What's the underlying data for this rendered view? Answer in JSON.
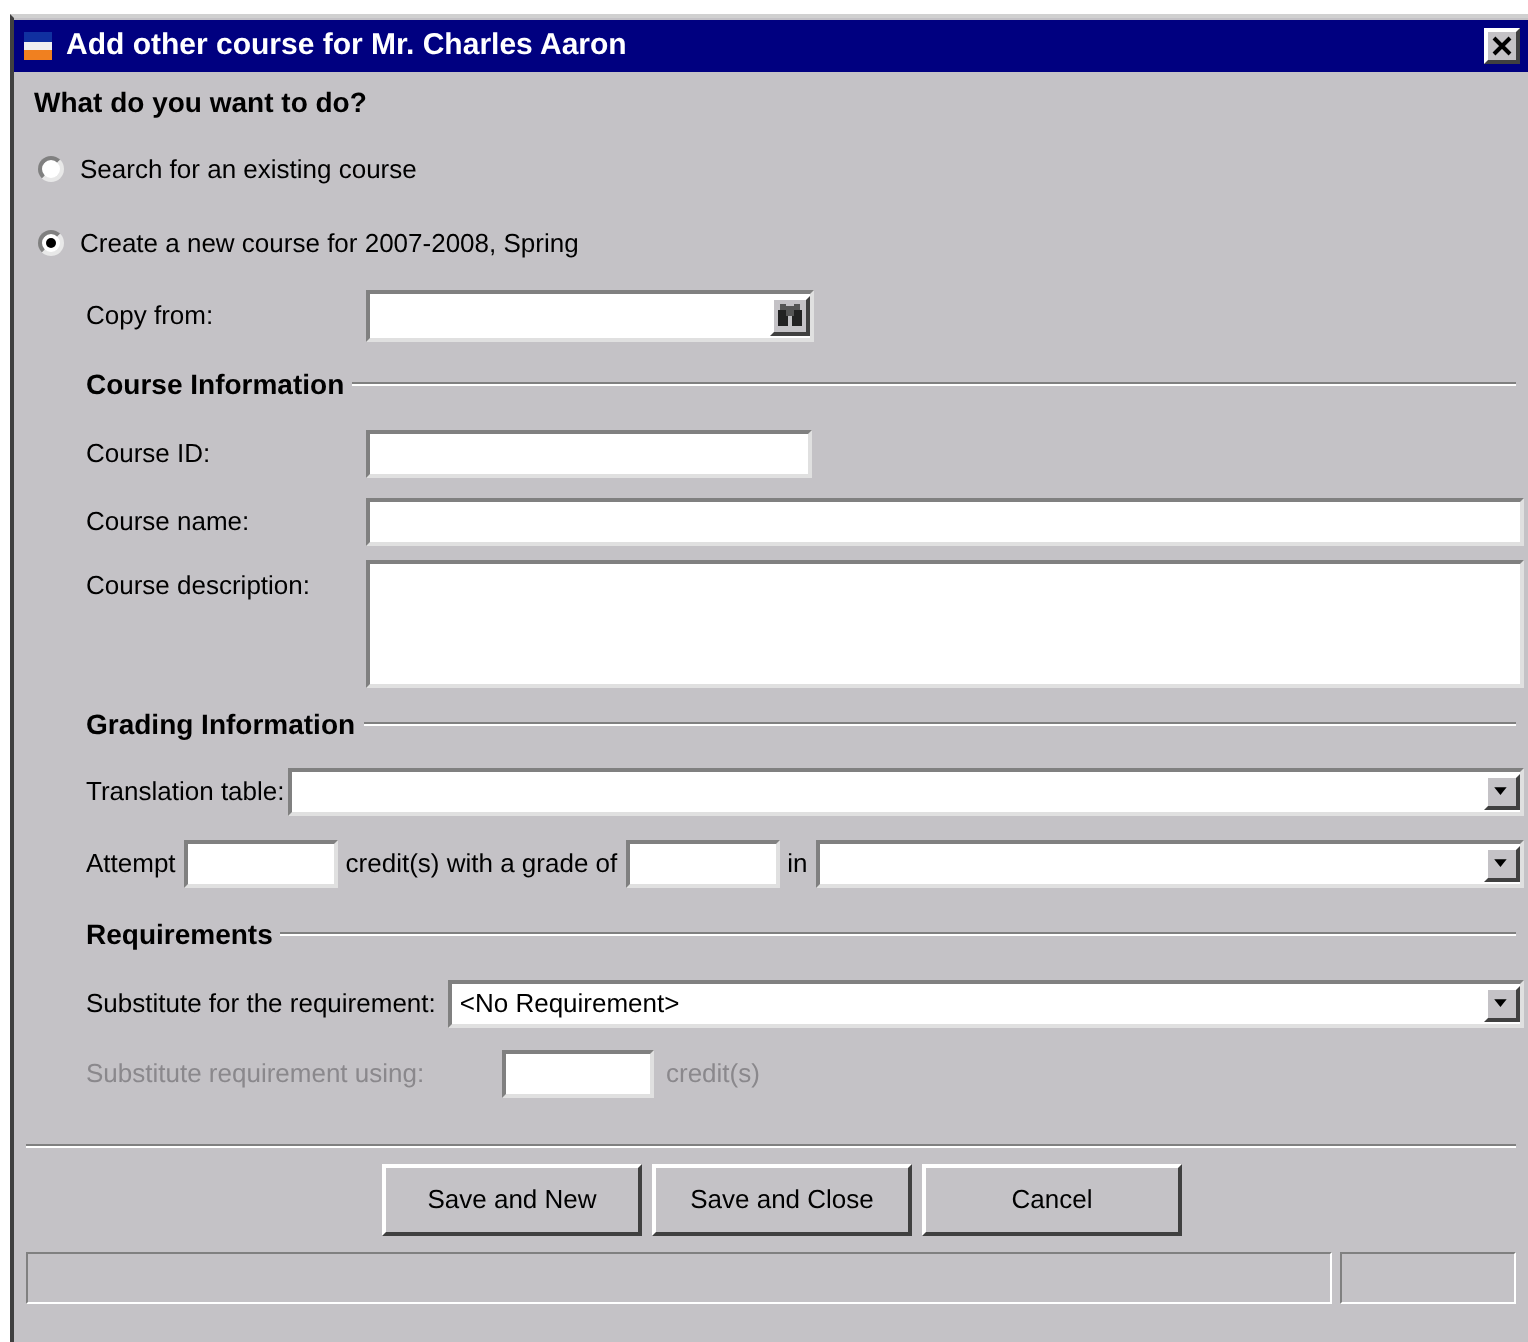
{
  "window": {
    "title": "Add other course for Mr. Charles Aaron"
  },
  "question": "What do you want to do?",
  "options": [
    {
      "label": "Search for an existing course",
      "selected": false
    },
    {
      "label": "Create a new course for 2007-2008, Spring",
      "selected": true
    }
  ],
  "copy_from": {
    "label": "Copy from:"
  },
  "course_information": {
    "heading": "Course Information",
    "course_id": {
      "label": "Course ID:"
    },
    "course_name": {
      "label": "Course name:"
    },
    "course_description": {
      "label": "Course description:"
    }
  },
  "grading_information": {
    "heading": "Grading Information",
    "translation_table": {
      "label": "Translation table:"
    },
    "attempt": {
      "label": "Attempt",
      "middle": "credit(s) with a grade of",
      "in": "in"
    }
  },
  "requirements": {
    "heading": "Requirements",
    "substitute_for": {
      "label": "Substitute for the requirement:",
      "value": "<No Requirement>",
      "disabled": false
    },
    "substitute_using": {
      "label": "Substitute requirement using:",
      "suffix": "credit(s)",
      "disabled": true
    }
  },
  "buttons": [
    "Save and New",
    "Save and Close",
    "Cancel"
  ]
}
